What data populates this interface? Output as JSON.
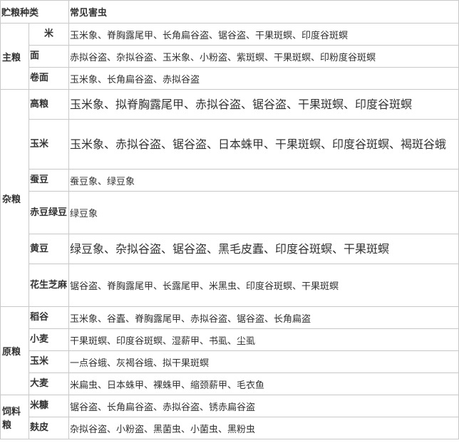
{
  "header": {
    "category": "贮粮种类",
    "pests": "常见害虫"
  },
  "groups": [
    {
      "category": "主粮",
      "rows": [
        {
          "kind": "米",
          "pests": "玉米象、脊胸露尾甲、长角扁谷盗、锯谷盗、干果斑螟、印度谷斑螟"
        },
        {
          "kind": "面",
          "pests": "赤拟谷盗、杂拟谷盗、玉米象、小粉盗、紫斑螟、干果斑螟、印粉度谷斑螟"
        },
        {
          "kind": "卷面",
          "pests": "玉米象、长角扁谷盗、赤拟谷盗"
        }
      ]
    },
    {
      "category": "杂粮",
      "rows": [
        {
          "kind": "高粮",
          "pests": "玉米象、拟脊胸露尾甲、赤拟谷盗、锯谷盗、干果斑螟、印度谷斑螟"
        },
        {
          "kind": "玉米",
          "pests": "玉米象、赤拟谷盗、锯谷盗、日本蛛甲、干果斑螟、印度谷斑螟、褐斑谷蛾"
        },
        {
          "kind": "蚕豆",
          "pests": "蚕豆象、绿豆象"
        },
        {
          "kind": "赤豆绿豆",
          "pests": "绿豆象"
        },
        {
          "kind": "黄豆",
          "pests": "绿豆象、杂拟谷盗、锯谷盗、黑毛皮蠹、印度谷斑螟、干果斑螟"
        },
        {
          "kind": "花生芝麻",
          "pests": "锯谷盗、脊胸露尾甲、长露尾甲、米黑虫、印度谷斑螟、干果斑螟"
        }
      ]
    },
    {
      "category": "原粮",
      "rows": [
        {
          "kind": "稻谷",
          "pests": "玉米象、谷蠹、脊胸露尾甲、赤拟谷盗、锯谷盗、长角扁盗"
        },
        {
          "kind": "小麦",
          "pests": "干果斑螟、印度谷斑螟、湿薪甲、书虱、尘虱"
        },
        {
          "kind": "玉米",
          "pests": "一点谷蛾、灰褐谷蛾、拟干果斑螟"
        },
        {
          "kind": "大麦",
          "pests": "米扁虫、日本蛛甲、裸蛛甲、缩颈薪甲、毛衣鱼"
        }
      ]
    },
    {
      "category": "饲料粮",
      "rows": [
        {
          "kind": "米糠",
          "pests": "锯谷盗、长角扁谷盗、赤拟谷盗、锈赤扁谷盗"
        },
        {
          "kind": "麸皮",
          "pests": "杂拟谷盗、小粉盗、黑菌虫、小菌虫、黑粉虫"
        }
      ]
    }
  ]
}
